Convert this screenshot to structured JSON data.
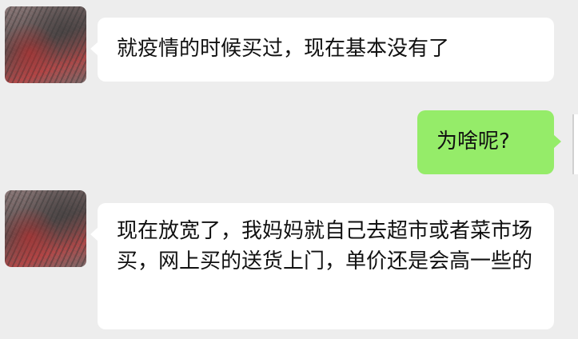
{
  "chat": {
    "messages": [
      {
        "sender": "other",
        "avatar_icon": "contact-avatar-icon",
        "text": "就疫情的时候买过，现在基本没有了"
      },
      {
        "sender": "self",
        "text": "为啥呢?"
      },
      {
        "sender": "other",
        "avatar_icon": "contact-avatar-icon",
        "text": "现在放宽了，我妈妈就自己去超市或者菜市场买，网上买的送货上门，单价还是会高一些的"
      }
    ]
  },
  "colors": {
    "background": "#ededed",
    "incoming_bubble": "#ffffff",
    "outgoing_bubble": "#95ec69",
    "text": "#111111"
  }
}
